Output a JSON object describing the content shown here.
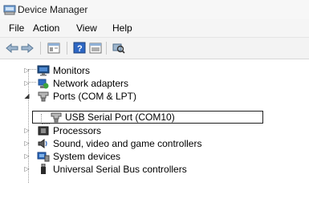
{
  "window": {
    "title": "Device Manager"
  },
  "menu": {
    "items": [
      "File",
      "Action",
      "View",
      "Help"
    ]
  },
  "toolbar": {
    "buttons": [
      "back-icon",
      "forward-icon",
      "properties-icon",
      "help-icon",
      "update-driver-icon",
      "scan-hardware-icon"
    ]
  },
  "tree": {
    "monitors": "Monitors",
    "network_adapters": "Network adapters",
    "ports": "Ports (COM & LPT)",
    "usb_serial": "USB Serial Port (COM10)",
    "processors": "Processors",
    "sound": "Sound, video and game controllers",
    "system_devices": "System devices",
    "usb_controllers": "Universal Serial Bus controllers"
  }
}
